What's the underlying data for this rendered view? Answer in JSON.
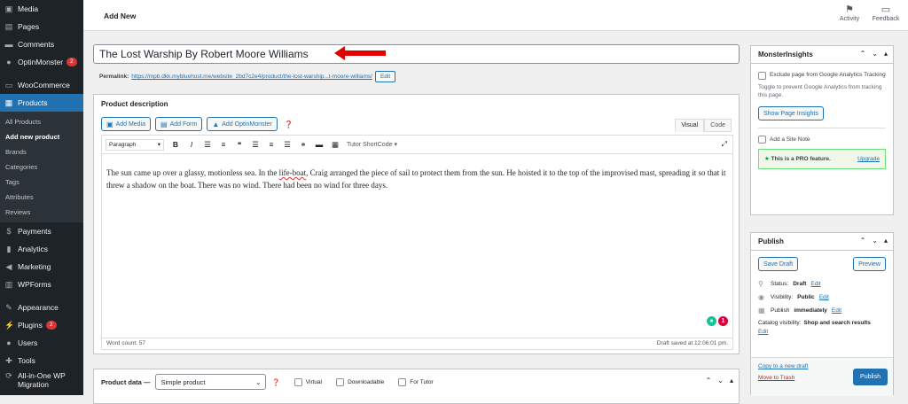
{
  "sidebar": {
    "items_top": [
      {
        "label": "Media",
        "icon": "media-icon"
      },
      {
        "label": "Pages",
        "icon": "pages-icon"
      },
      {
        "label": "Comments",
        "icon": "comments-icon"
      },
      {
        "label": "OptinMonster",
        "icon": "optinmonster-icon",
        "badge": "2"
      }
    ],
    "woo": {
      "label": "WooCommerce",
      "icon": "woocommerce-icon"
    },
    "products": {
      "label": "Products",
      "icon": "products-icon"
    },
    "submenu": [
      "All Products",
      "Add new product",
      "Brands",
      "Categories",
      "Tags",
      "Attributes",
      "Reviews"
    ],
    "items_bottom": [
      {
        "label": "Payments",
        "icon": "payments-icon"
      },
      {
        "label": "Analytics",
        "icon": "analytics-icon"
      },
      {
        "label": "Marketing",
        "icon": "marketing-icon"
      },
      {
        "label": "WPForms",
        "icon": "wpforms-icon"
      }
    ],
    "items_more": [
      {
        "label": "Appearance",
        "icon": "appearance-icon"
      },
      {
        "label": "Plugins",
        "icon": "plugins-icon",
        "badge": "2"
      },
      {
        "label": "Users",
        "icon": "users-icon"
      },
      {
        "label": "Tools",
        "icon": "tools-icon"
      },
      {
        "label": "All-in-One WP Migration",
        "icon": "migration-icon"
      }
    ]
  },
  "topbar": {
    "title": "Add New",
    "activity": "Activity",
    "feedback": "Feedback"
  },
  "post": {
    "title": "The Lost Warship By Robert Moore Williams",
    "permalink_label": "Permalink:",
    "permalink_url": "https://mpb.dkk.mybluehost.me/website_2bd7c2e4/product/the-lost-warship...t-moore-williams/",
    "edit": "Edit"
  },
  "editor": {
    "heading": "Product description",
    "add_media": "Add Media",
    "add_form": "Add Form",
    "add_optinmonster": "Add OptinMonster",
    "tab_visual": "Visual",
    "tab_code": "Code",
    "format": "Paragraph",
    "shortcode": "Tutor ShortCode",
    "content_pre": "The sun came up over a glassy, motionless sea. In the ",
    "content_spell": "life-boat",
    "content_post": ", Craig arranged the piece of sail to protect them from the sun. He hoisted it to the top of the improvised mast, spreading it so that it threw a shadow on the boat. There was no wind. There had been no wind for three days.",
    "word_count": "Word count: 57",
    "draft_saved": "Draft saved at 12:06:01 pm.",
    "grammarly_count": "1"
  },
  "product_data": {
    "label": "Product data —",
    "type": "Simple product",
    "virtual": "Virtual",
    "downloadable": "Downloadable",
    "for_tutor": "For Tutor"
  },
  "monster": {
    "title": "MonsterInsights",
    "exclude": "Exclude page from Google Analytics Tracking",
    "toggle_help": "Toggle to prevent Google Analytics from tracking this page.",
    "show_insights": "Show Page Insights",
    "add_note": "Add a Site Note",
    "pro": "This is a PRO feature.",
    "upgrade": "Upgrade"
  },
  "publish": {
    "title": "Publish",
    "save_draft": "Save Draft",
    "preview": "Preview",
    "status_label": "Status:",
    "status": "Draft",
    "visibility_label": "Visibility:",
    "visibility": "Public",
    "publish_label": "Publish",
    "publish_when": "immediately",
    "catalog_label": "Catalog visibility:",
    "catalog": "Shop and search results",
    "edit": "Edit",
    "copy_draft": "Copy to a new draft",
    "trash": "Move to Trash",
    "publish_btn": "Publish"
  },
  "colors": {
    "accent": "#2271b1",
    "sidebar": "#1d2327",
    "badge": "#d63638",
    "arrow": "#e00000"
  }
}
